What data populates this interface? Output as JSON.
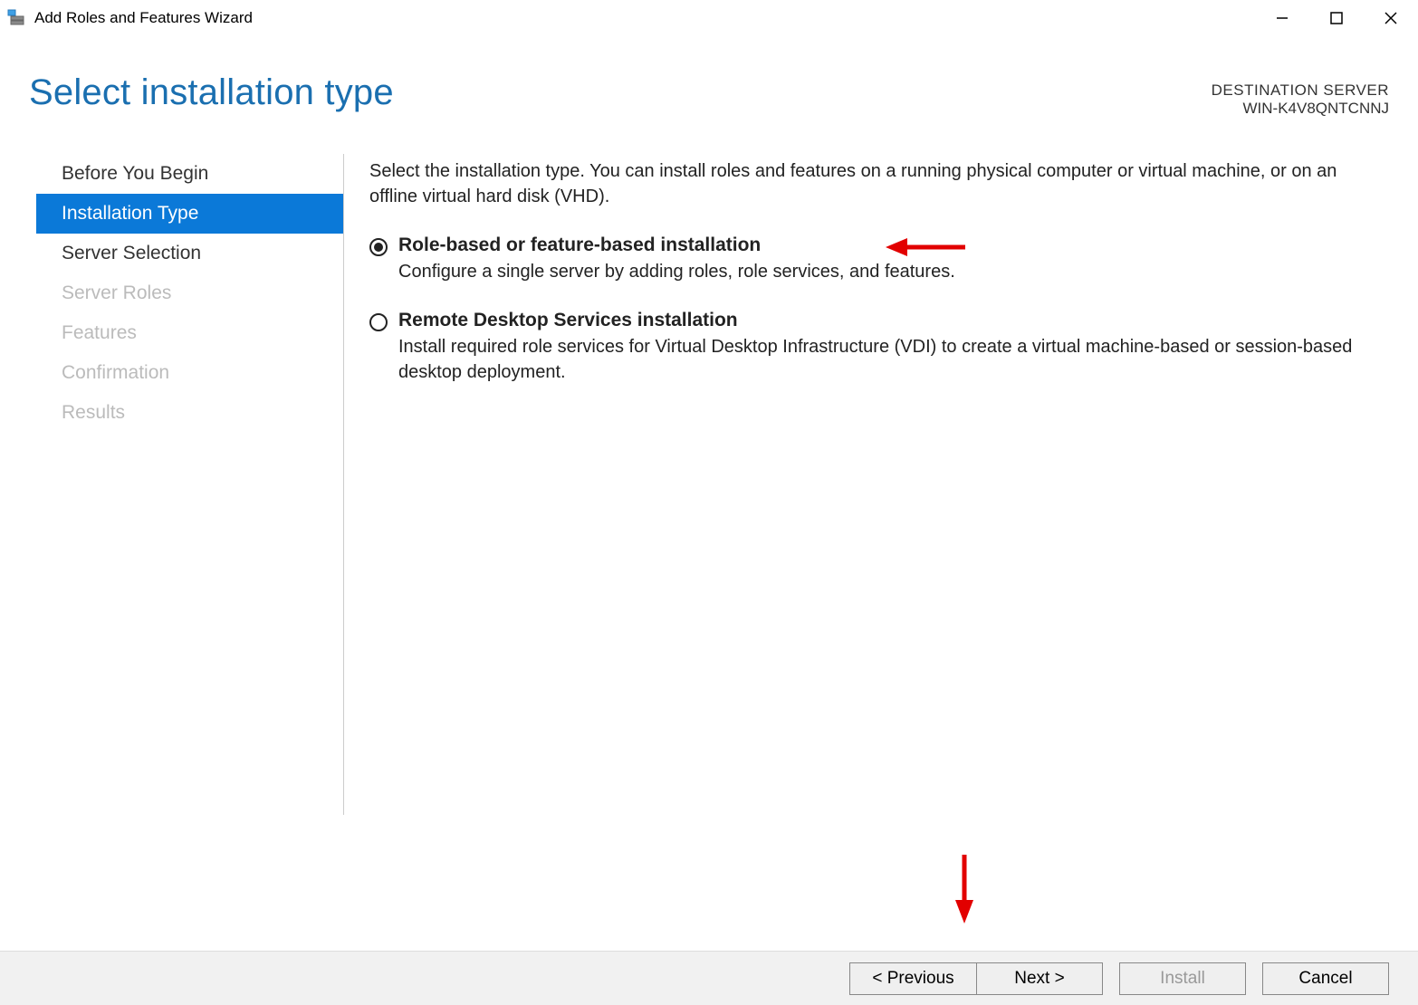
{
  "window": {
    "title": "Add Roles and Features Wizard"
  },
  "header": {
    "page_title": "Select installation type",
    "destination_label": "DESTINATION SERVER",
    "destination_value": "WIN-K4V8QNTCNNJ"
  },
  "sidebar": {
    "steps": [
      {
        "label": "Before You Begin",
        "state": "normal"
      },
      {
        "label": "Installation Type",
        "state": "selected"
      },
      {
        "label": "Server Selection",
        "state": "normal"
      },
      {
        "label": "Server Roles",
        "state": "disabled"
      },
      {
        "label": "Features",
        "state": "disabled"
      },
      {
        "label": "Confirmation",
        "state": "disabled"
      },
      {
        "label": "Results",
        "state": "disabled"
      }
    ]
  },
  "content": {
    "intro": "Select the installation type. You can install roles and features on a running physical computer or virtual machine, or on an offline virtual hard disk (VHD).",
    "options": [
      {
        "title": "Role-based or feature-based installation",
        "description": "Configure a single server by adding roles, role services, and features.",
        "checked": true
      },
      {
        "title": "Remote Desktop Services installation",
        "description": "Install required role services for Virtual Desktop Infrastructure (VDI) to create a virtual machine-based or session-based desktop deployment.",
        "checked": false
      }
    ]
  },
  "footer": {
    "previous": "< Previous",
    "next": "Next >",
    "install": "Install",
    "cancel": "Cancel"
  }
}
